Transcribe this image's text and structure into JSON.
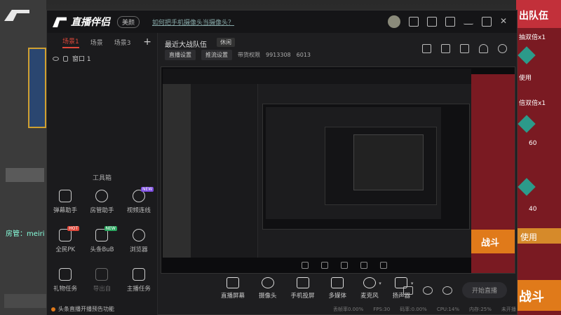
{
  "background": {
    "owner_label": "房管：",
    "owner_name": "meiri",
    "right_banner": "出队伍",
    "right_items": [
      "抽双倍x1",
      "使用",
      "倍双倍x1",
      "60",
      "40",
      "使用"
    ],
    "right_btn": "使用",
    "right_fight": "战斗"
  },
  "app": {
    "brand": "直播伴侣",
    "edition_badge": "美颜",
    "title_link": "如何把手机摄像头当摄像头？",
    "left_tabs": [
      "场景1",
      "场景",
      "场景3"
    ],
    "scene_item": "窗口 1",
    "tools_title": "工具箱",
    "tools": [
      {
        "label": "弹幕助手",
        "icon": "danmaku-icon",
        "tag": ""
      },
      {
        "label": "房管助手",
        "icon": "admin-icon",
        "tag": ""
      },
      {
        "label": "视频连线",
        "icon": "video-link-icon",
        "tag": "NEW"
      },
      {
        "label": "全民PK",
        "icon": "pk-icon",
        "tag": "HOT"
      },
      {
        "label": "头条BuB",
        "icon": "headline-icon",
        "tag": "NEW"
      },
      {
        "label": "浏览器",
        "icon": "browser-icon",
        "tag": ""
      },
      {
        "label": "礼物任务",
        "icon": "gift-icon",
        "tag": ""
      },
      {
        "label": "导出自",
        "icon": "download-icon",
        "tag": ""
      },
      {
        "label": "主播任务",
        "icon": "task-icon",
        "tag": ""
      }
    ],
    "left_footer": "头条直播开播预告功能",
    "room_title": "最近大战队伍",
    "room_category": "休闲",
    "room_meta": [
      "直播设置",
      "推流设置",
      "带货权限",
      "9913308",
      "6013"
    ],
    "toolbar": [
      {
        "label": "直播屏幕",
        "icon": "screen-icon",
        "caret": false
      },
      {
        "label": "摄像头",
        "icon": "camera-icon",
        "caret": false
      },
      {
        "label": "手机投屏",
        "icon": "phone-cast-icon",
        "caret": false
      },
      {
        "label": "多媒体",
        "icon": "media-icon",
        "caret": false
      },
      {
        "label": "麦克风",
        "icon": "mic-icon",
        "caret": true
      },
      {
        "label": "扬声器",
        "icon": "speaker-icon",
        "caret": true
      }
    ],
    "start_button": "开始直播",
    "status": [
      "丢帧率0.00%",
      "FPS:30",
      "码率:0.00%",
      "CPU:14%",
      "内存:25%",
      "未开播"
    ],
    "preview_fight": "战斗"
  }
}
